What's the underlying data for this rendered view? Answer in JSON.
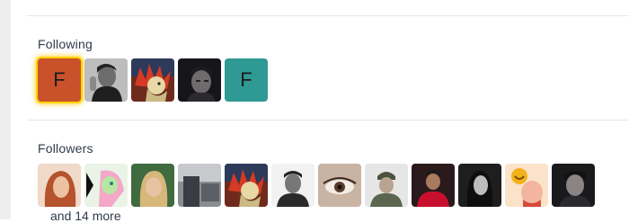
{
  "following": {
    "title": "Following",
    "avatars": [
      {
        "type": "letter",
        "letter": "F",
        "color": "#c9522b",
        "highlighted": true
      },
      {
        "type": "photo",
        "name": "following-avatar-2"
      },
      {
        "type": "photo",
        "name": "following-avatar-3"
      },
      {
        "type": "photo",
        "name": "following-avatar-4"
      },
      {
        "type": "letter",
        "letter": "F",
        "color": "#2e9a93",
        "highlighted": false
      }
    ]
  },
  "followers": {
    "title": "Followers",
    "more_label": "and 14 more"
  },
  "colors": {
    "text": "#2f3b4c",
    "divider": "#e6e6e6",
    "highlight": "#ffd200"
  }
}
